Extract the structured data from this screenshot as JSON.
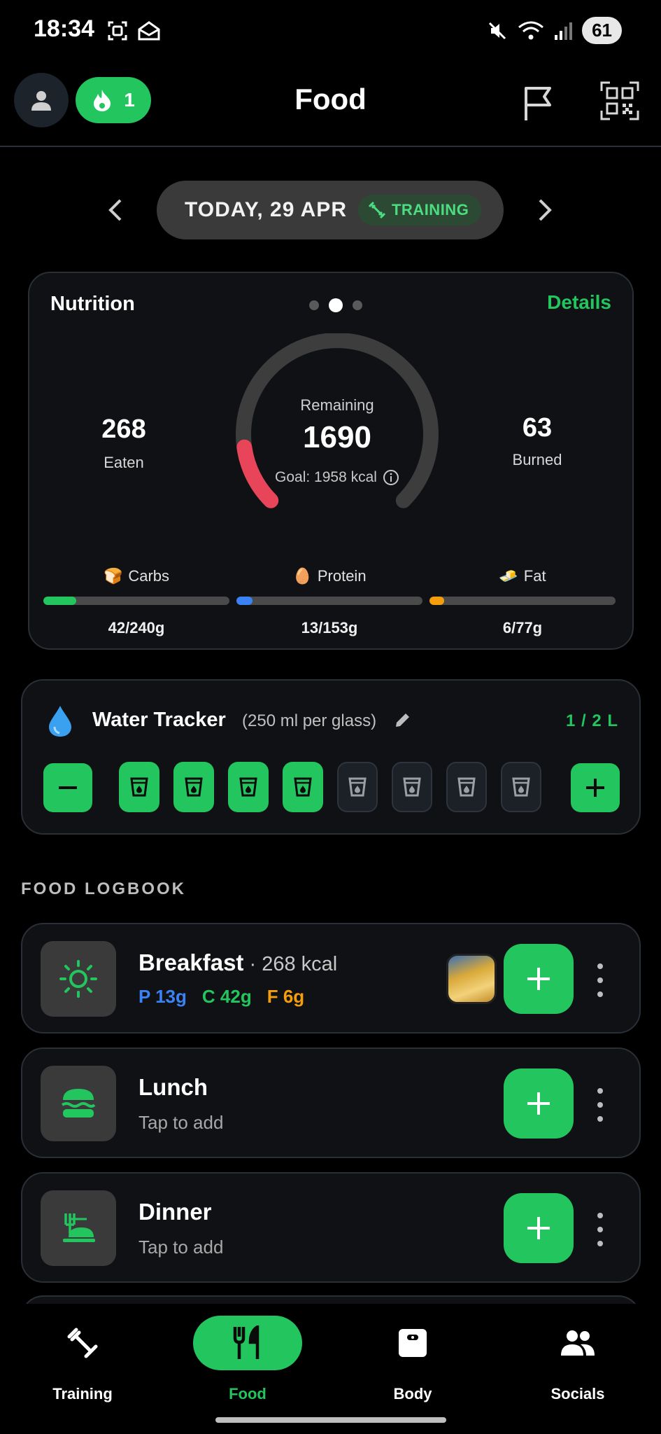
{
  "status_bar": {
    "time": "18:34",
    "battery": "61"
  },
  "app_bar": {
    "title": "Food",
    "streak_count": "1"
  },
  "date_selector": {
    "date_label": "TODAY, 29 APR",
    "badge": "TRAINING"
  },
  "nutrition": {
    "title": "Nutrition",
    "details_label": "Details",
    "eaten_value": "268",
    "eaten_label": "Eaten",
    "burned_value": "63",
    "burned_label": "Burned",
    "remaining_label": "Remaining",
    "remaining_value": "1690",
    "goal_label": "Goal: 1958 kcal",
    "consumed_fraction": 0.137,
    "macros": [
      {
        "emoji": "🍞",
        "name": "Carbs",
        "value": "42/240g",
        "fraction": 0.175,
        "color": "#22c55e"
      },
      {
        "emoji": "🥚",
        "name": "Protein",
        "value": "13/153g",
        "fraction": 0.085,
        "color": "#3b82f6"
      },
      {
        "emoji": "🧈",
        "name": "Fat",
        "value": "6/77g",
        "fraction": 0.078,
        "color": "#f59e0b"
      }
    ]
  },
  "water": {
    "title": "Water Tracker",
    "subtitle": "(250 ml per glass)",
    "total": "1 / 2 L",
    "glasses_filled": 4,
    "glasses_total": 8
  },
  "logbook": {
    "section_label": "FOOD LOGBOOK",
    "breakfast": {
      "name": "Breakfast",
      "kcal": " · 268 kcal",
      "p": "P 13g",
      "c": "C 42g",
      "f": "F 6g"
    },
    "lunch": {
      "name": "Lunch",
      "hint": "Tap to add"
    },
    "dinner": {
      "name": "Dinner",
      "hint": "Tap to add"
    }
  },
  "colors": {
    "accent": "#22c55e",
    "protein": "#3b82f6",
    "carbs": "#22c55e",
    "fat": "#f59e0b",
    "gauge_consumed": "#e8455a"
  },
  "nav": {
    "training": "Training",
    "food": "Food",
    "body": "Body",
    "socials": "Socials"
  }
}
